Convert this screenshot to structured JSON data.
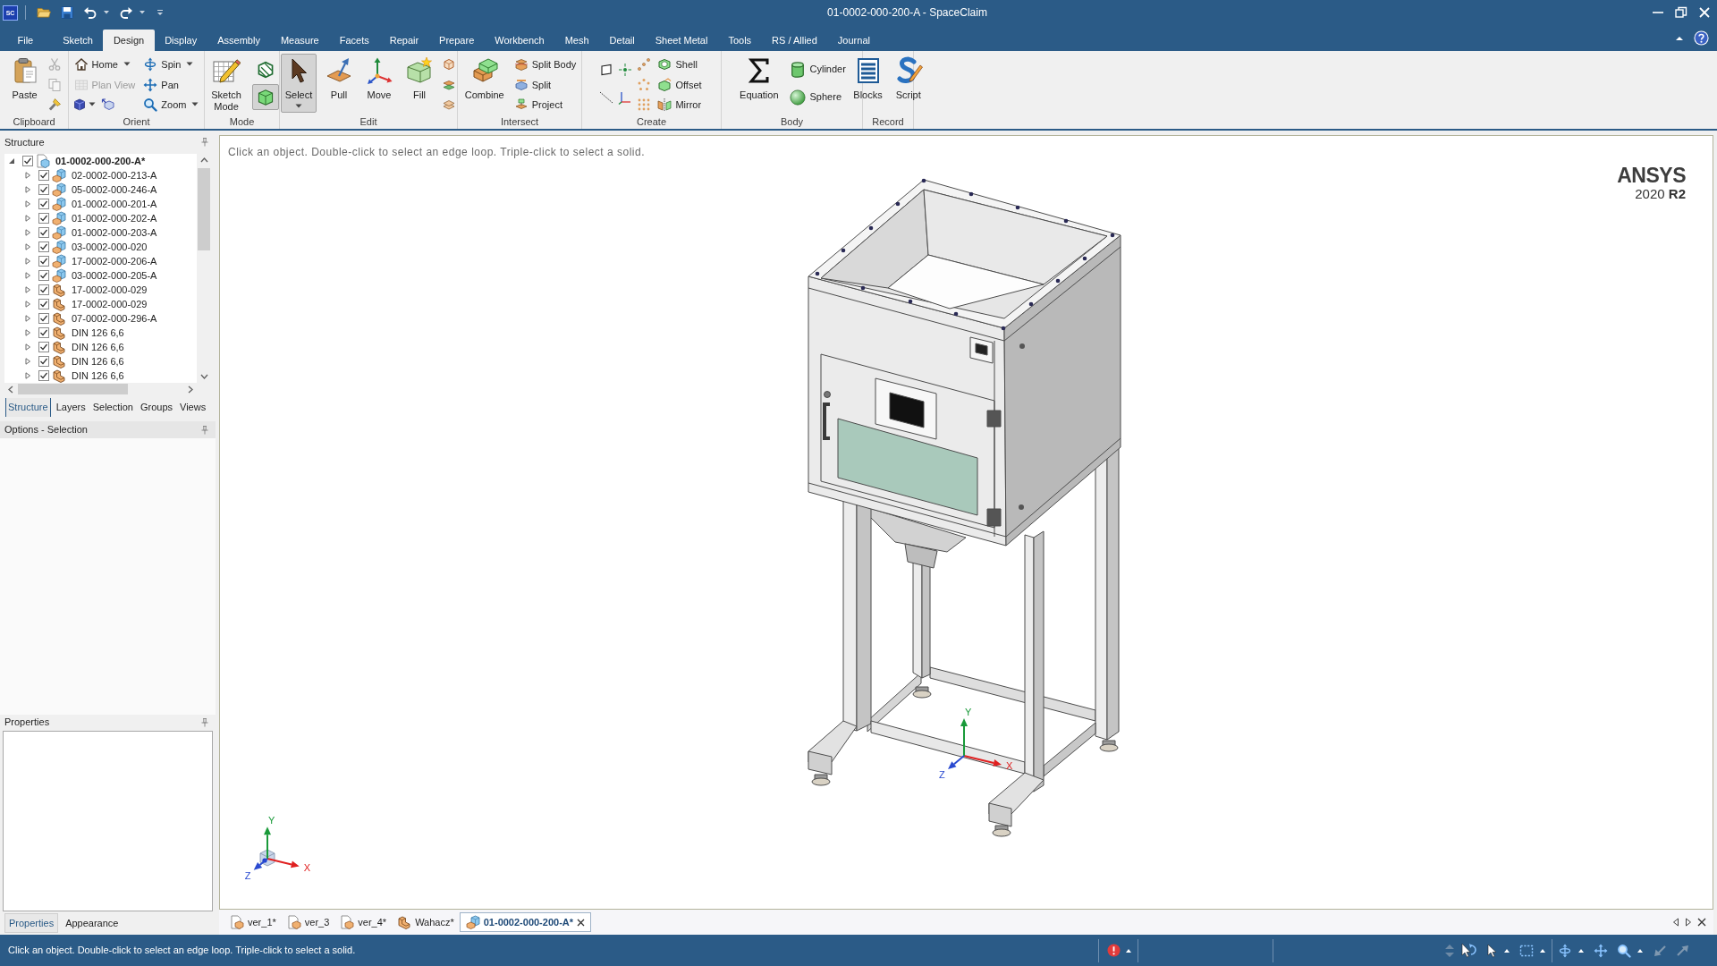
{
  "window": {
    "title": "01-0002-000-200-A - SpaceClaim",
    "app_badge": "SC"
  },
  "ribbon": {
    "tabs": [
      {
        "label": "File",
        "selected": false
      },
      {
        "label": "Sketch",
        "selected": false
      },
      {
        "label": "Design",
        "selected": true
      },
      {
        "label": "Display",
        "selected": false
      },
      {
        "label": "Assembly",
        "selected": false
      },
      {
        "label": "Measure",
        "selected": false
      },
      {
        "label": "Facets",
        "selected": false
      },
      {
        "label": "Repair",
        "selected": false
      },
      {
        "label": "Prepare",
        "selected": false
      },
      {
        "label": "Workbench",
        "selected": false
      },
      {
        "label": "Mesh",
        "selected": false
      },
      {
        "label": "Detail",
        "selected": false
      },
      {
        "label": "Sheet Metal",
        "selected": false
      },
      {
        "label": "Tools",
        "selected": false
      },
      {
        "label": "RS / Allied",
        "selected": false
      },
      {
        "label": "Journal",
        "selected": false
      }
    ],
    "groups": [
      {
        "label": "Clipboard",
        "tools": [
          {
            "label": "Paste",
            "disabled": false
          },
          {
            "disabled": true
          },
          {
            "disabled": true
          },
          {
            "disabled": false
          }
        ]
      },
      {
        "label": "Orient",
        "tools": [
          {
            "label": "Home",
            "disabled": false,
            "dropdown": true
          },
          {
            "label": "Plan View",
            "disabled": true
          },
          {
            "disabled": false,
            "dropdown": true
          },
          {
            "disabled": false
          },
          {
            "label": "Spin",
            "disabled": false,
            "dropdown": true
          },
          {
            "label": "Pan",
            "disabled": false
          },
          {
            "label": "Zoom",
            "disabled": false,
            "dropdown": true
          }
        ]
      },
      {
        "label": "Mode",
        "tools": [
          {
            "label": "Sketch Mode",
            "selected": false
          },
          {
            "selected": false
          },
          {
            "selected": true
          }
        ]
      },
      {
        "label": "Edit",
        "tools": [
          {
            "label": "Select",
            "selected": true,
            "dropdown": true
          },
          {
            "label": "Pull",
            "selected": false
          },
          {
            "label": "Move",
            "selected": false
          },
          {
            "label": "Fill",
            "selected": false
          }
        ]
      },
      {
        "label": "Intersect",
        "tools": [
          {
            "label": "Combine"
          },
          {
            "label": "Split Body"
          },
          {
            "label": "Split"
          },
          {
            "label": "Project"
          }
        ]
      },
      {
        "label": "Create",
        "tools": [
          {
            "label": "Shell"
          },
          {
            "label": "Offset"
          },
          {
            "label": "Mirror"
          }
        ]
      },
      {
        "label": "Body",
        "tools": [
          {
            "label": "Equation"
          },
          {
            "label": "Cylinder"
          },
          {
            "label": "Sphere"
          }
        ]
      },
      {
        "label": "Record",
        "tools": [
          {
            "label": "Blocks"
          },
          {
            "label": "Script"
          }
        ]
      }
    ]
  },
  "structure": {
    "title": "Structure",
    "tree": [
      {
        "label": "01-0002-000-200-A*",
        "kind": "assembly",
        "checked": true,
        "expanded": true,
        "children": [
          {
            "label": "02-0002-000-213-A",
            "kind": "component",
            "checked": true,
            "expanded": false
          },
          {
            "label": "05-0002-000-246-A",
            "kind": "component",
            "checked": true,
            "expanded": false
          },
          {
            "label": "01-0002-000-201-A",
            "kind": "component",
            "checked": true,
            "expanded": false
          },
          {
            "label": "01-0002-000-202-A",
            "kind": "component",
            "checked": true,
            "expanded": false
          },
          {
            "label": "01-0002-000-203-A",
            "kind": "component",
            "checked": true,
            "expanded": false
          },
          {
            "label": "03-0002-000-020",
            "kind": "component",
            "checked": true,
            "expanded": false
          },
          {
            "label": "17-0002-000-206-A",
            "kind": "component",
            "checked": true,
            "expanded": false
          },
          {
            "label": "03-0002-000-205-A",
            "kind": "component",
            "checked": true,
            "expanded": false
          },
          {
            "label": "17-0002-000-029",
            "kind": "part",
            "checked": true,
            "expanded": false
          },
          {
            "label": "17-0002-000-029",
            "kind": "part",
            "checked": true,
            "expanded": false
          },
          {
            "label": "07-0002-000-296-A",
            "kind": "part",
            "checked": true,
            "expanded": false
          },
          {
            "label": "DIN 126 6,6",
            "kind": "part",
            "checked": true,
            "expanded": false
          },
          {
            "label": "DIN 126 6,6",
            "kind": "part",
            "checked": true,
            "expanded": false
          },
          {
            "label": "DIN 126 6,6",
            "kind": "part",
            "checked": true,
            "expanded": false
          },
          {
            "label": "DIN 126 6,6",
            "kind": "part",
            "checked": true,
            "expanded": false
          }
        ]
      }
    ]
  },
  "panel_tabs": [
    {
      "label": "Structure",
      "selected": true
    },
    {
      "label": "Layers",
      "selected": false
    },
    {
      "label": "Selection",
      "selected": false
    },
    {
      "label": "Groups",
      "selected": false
    },
    {
      "label": "Views",
      "selected": false
    }
  ],
  "options": {
    "title": "Options - Selection"
  },
  "properties": {
    "title": "Properties"
  },
  "property_tabs": [
    {
      "label": "Properties",
      "selected": true
    },
    {
      "label": "Appearance",
      "selected": false
    }
  ],
  "viewport": {
    "hint": "Click an object. Double-click to select an edge loop. Triple-click to select a solid.",
    "logo": "ANSYS",
    "version": "2020 **R2**",
    "model_axes": [
      "X",
      "Y",
      "Z"
    ],
    "view_axes": [
      "X",
      "Y",
      "Z"
    ]
  },
  "document_tabs": [
    {
      "label": "ver_1*",
      "kind": "design",
      "selected": false
    },
    {
      "label": "ver_3",
      "kind": "design",
      "selected": false
    },
    {
      "label": "ver_4*",
      "kind": "design",
      "selected": false
    },
    {
      "label": "Wahacz*",
      "kind": "part",
      "selected": false
    },
    {
      "label": "01-0002-000-200-A*",
      "kind": "component",
      "selected": true
    }
  ],
  "status_bar": {
    "message": "Click an object. Double-click to select an edge loop. Triple-click to select a solid."
  }
}
